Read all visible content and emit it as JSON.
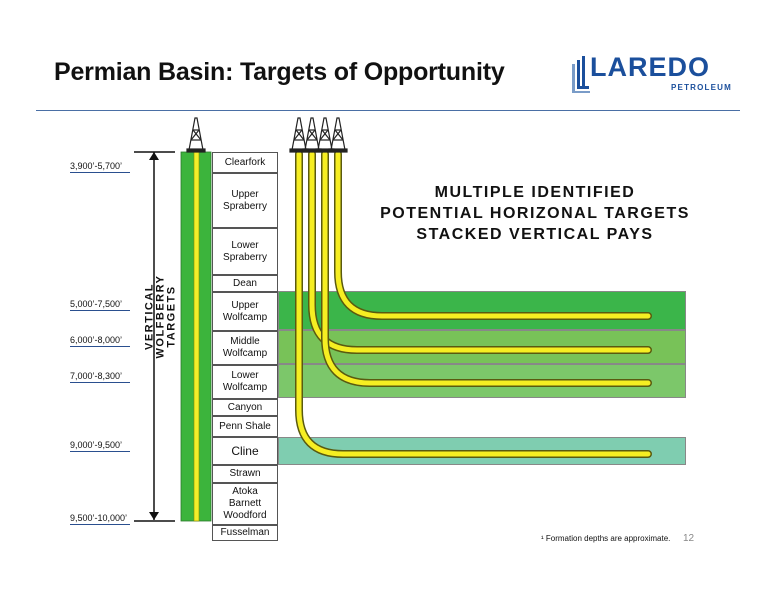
{
  "title": "Permian Basin: Targets of Opportunity",
  "logo": {
    "name": "LAREDO",
    "sub": "PETROLEUM"
  },
  "heading": [
    "MULTIPLE IDENTIFIED",
    "POTENTIAL HORIZONAL TARGETS",
    "STACKED VERTICAL PAYS"
  ],
  "vertical_label": "VERTICAL WOLFBERRY TARGETS",
  "depths": [
    "3,900’-5,700’",
    "5,000’-7,500’",
    "6,000’-8,000’",
    "7,000’-8,300’",
    "9,000’-9,500’",
    "9,500’-10,000’"
  ],
  "formations": [
    "Clearfork",
    "Upper Spraberry",
    "Lower Spraberry",
    "Dean",
    "Upper Wolfcamp",
    "Middle Wolfcamp",
    "Lower Wolfcamp",
    "Canyon",
    "Penn Shale",
    "Cline",
    "Strawn",
    "Atoka Barnett Woodford",
    "Fusselman"
  ],
  "zone_colors": {
    "upper_wolfcamp": "#3bb54a",
    "middle_wolfcamp": "#78c258",
    "lower_wolfcamp": "#7cc76a",
    "cline": "#7fcdb0"
  },
  "footnote": "¹ Formation depths are approximate.",
  "page_number": "12"
}
